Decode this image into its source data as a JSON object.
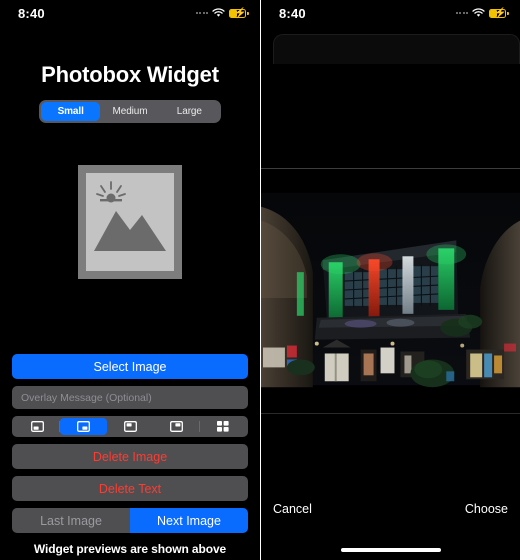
{
  "left_panel": {
    "status_bar": {
      "time": "8:40",
      "signal_icon": "signal-dots-icon",
      "wifi_icon": "wifi-icon",
      "battery_icon": "battery-charging-icon"
    },
    "title": "Photobox Widget",
    "size_segments": [
      {
        "label": "Small",
        "selected": true
      },
      {
        "label": "Medium",
        "selected": false
      },
      {
        "label": "Large",
        "selected": false
      }
    ],
    "preview": {
      "placeholder_icon": "photo-placeholder-icon"
    },
    "select_image_button": "Select Image",
    "overlay_field": {
      "value": "",
      "placeholder": "Overlay Message (Optional)"
    },
    "layout_segments": [
      {
        "icon": "layout-bottom-left-icon",
        "selected": false
      },
      {
        "icon": "layout-bottom-right-icon",
        "selected": true
      },
      {
        "icon": "layout-top-left-icon",
        "selected": false
      },
      {
        "icon": "layout-top-right-icon",
        "selected": false
      },
      {
        "icon": "layout-grid-icon",
        "selected": false
      }
    ],
    "delete_image_button": "Delete Image",
    "delete_text_button": "Delete Text",
    "last_image_button": "Last Image",
    "next_image_button": "Next Image",
    "footnote": "Widget previews are shown above"
  },
  "right_panel": {
    "status_bar": {
      "time": "8:40",
      "signal_icon": "signal-dots-icon",
      "wifi_icon": "wifi-icon",
      "battery_icon": "battery-charging-icon"
    },
    "photo": {
      "alt": "night-photo-illuminated-building",
      "description": "Night scene of a building facade lit with green, red and white floodlights"
    },
    "cancel_button": "Cancel",
    "choose_button": "Choose"
  },
  "colors": {
    "accent_blue": "#0a6cff",
    "destructive_red": "#ff3b30",
    "control_gray": "#4f4f52",
    "battery_yellow": "#f2c200",
    "background": "#000000"
  }
}
